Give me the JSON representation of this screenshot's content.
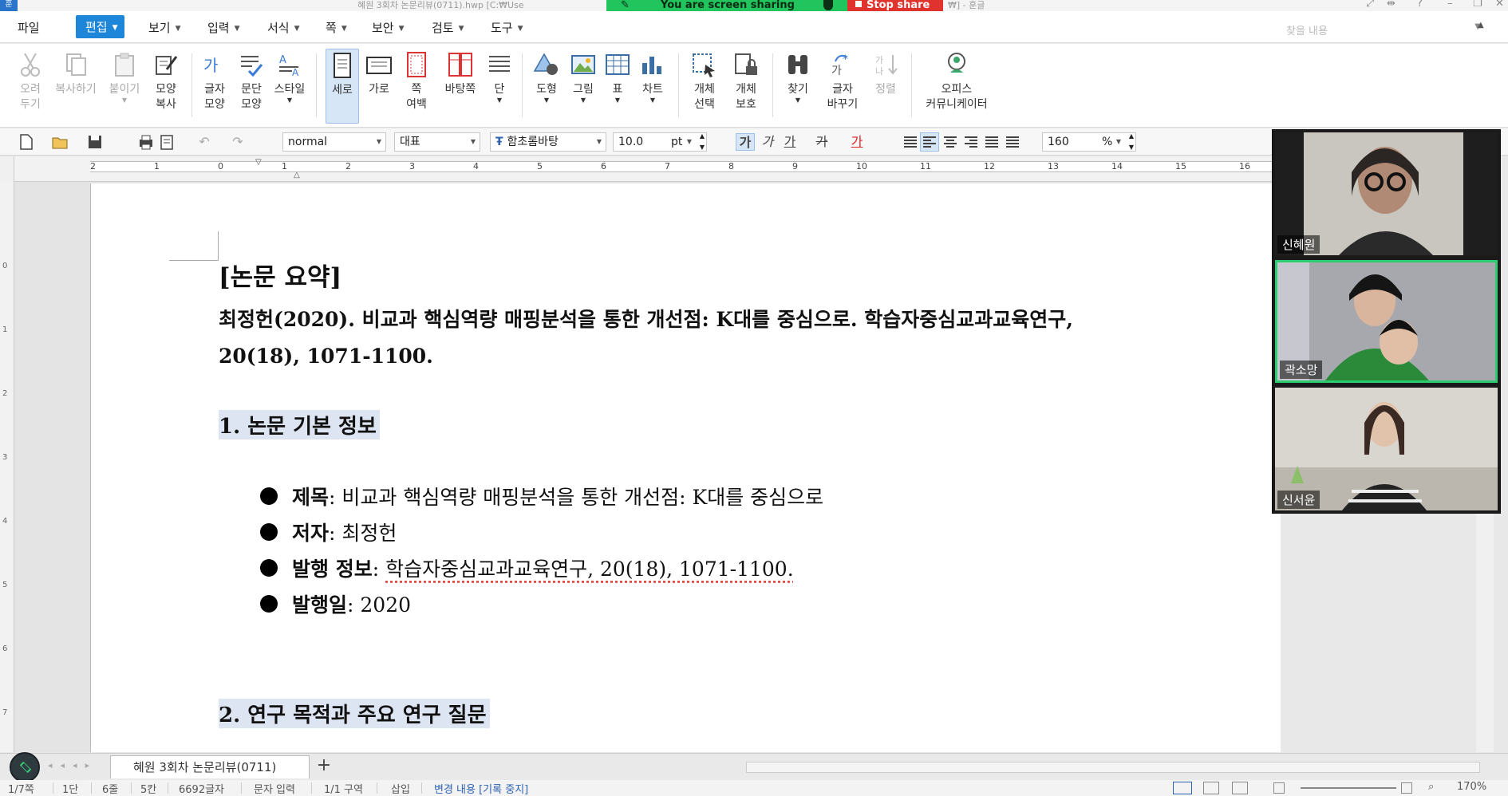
{
  "window": {
    "title_left": "혜원 3회차 논문리뷰(0711).hwp [C:₩Use",
    "title_right": "₩] - 훈글",
    "app_icon": "훈"
  },
  "share_banner": {
    "text": "You are screen sharing",
    "stop_label": "Stop share"
  },
  "menu": {
    "items": [
      "파일",
      "편집",
      "보기",
      "입력",
      "서식",
      "쪽",
      "보안",
      "검토",
      "도구"
    ],
    "active": "편집",
    "search_placeholder": "찾을 내용"
  },
  "ribbon": {
    "cut": "오려\n두기",
    "copy": "복사하기",
    "paste": "붙이기",
    "format_copy": "모양\n복사",
    "char_shape": "글자\n모양",
    "para_shape": "문단\n모양",
    "style": "스타일",
    "vertical": "세로",
    "horizontal": "가로",
    "page_margin": "쪽\n여백",
    "background": "바탕쪽",
    "columns": "단",
    "shape": "도형",
    "picture": "그림",
    "table": "표",
    "chart": "차트",
    "obj_select": "개체\n선택",
    "obj_protect": "개체\n보호",
    "find": "찾기",
    "replace": "글자\n바꾸기",
    "sort": "정렬",
    "office_comm": "오피스\n커뮤니케이터"
  },
  "toolbar": {
    "style_value": "normal",
    "para_value": "대표",
    "font_value": "함초롬바탕",
    "size_value": "10.0",
    "size_unit": "pt",
    "zoom_value": "160",
    "zoom_unit": "%",
    "bold": "가",
    "italic": "가",
    "underline": "가",
    "strike": "가",
    "color": "가"
  },
  "ruler": {
    "labels": [
      "2",
      "1",
      "0",
      "1",
      "2",
      "3",
      "4",
      "5",
      "6",
      "7",
      "8",
      "9",
      "10",
      "11",
      "12",
      "13",
      "14",
      "15",
      "16"
    ]
  },
  "vruler": {
    "labels": [
      "0",
      "1",
      "2",
      "3",
      "4",
      "5",
      "6",
      "7"
    ]
  },
  "document": {
    "summary_heading": "[논문 요약]",
    "citation_line1": "최정헌(2020). 비교과 핵심역량 매핑분석을 통한 개선점: K대를 중심으로. 학습자중심교과교육연구,",
    "citation_line2": "20(18), 1071-1100.",
    "section1": "1. 논문 기본 정보",
    "bullets": [
      {
        "label": "제목",
        "sep": ": ",
        "value": "비교과 핵심역량 매핑분석을 통한 개선점: K대를 중심으로"
      },
      {
        "label": "저자",
        "sep": ": ",
        "value": "최정헌"
      },
      {
        "label": "발행 정보",
        "sep": ": ",
        "value": "학습자중심교과교육연구, 20(18), 1071-1100."
      },
      {
        "label": "발행일",
        "sep": ": ",
        "value": "2020"
      }
    ],
    "section2": "2. 연구 목적과 주요 연구 질문"
  },
  "participants": [
    {
      "name": "신혜원",
      "active_speaker": false
    },
    {
      "name": "곽소망",
      "active_speaker": true
    },
    {
      "name": "신서윤",
      "active_speaker": false
    }
  ],
  "tabs": {
    "doc_tab": "혜원 3회차 논문리뷰(0711)",
    "add": "+"
  },
  "status": {
    "page": "1/7쪽",
    "col": "1단",
    "line": "6줄",
    "pos": "5칸",
    "chars": "6692글자",
    "mode": "문자 입력",
    "section": "1/1 구역",
    "insert": "삽입",
    "track": "변경 내용 [기록 중지]",
    "zoom": "170%"
  },
  "colors": {
    "accent": "#1e86d8",
    "share_green": "#21c45d",
    "stop_red": "#e0332e",
    "speaker_border": "#2ecc71"
  }
}
